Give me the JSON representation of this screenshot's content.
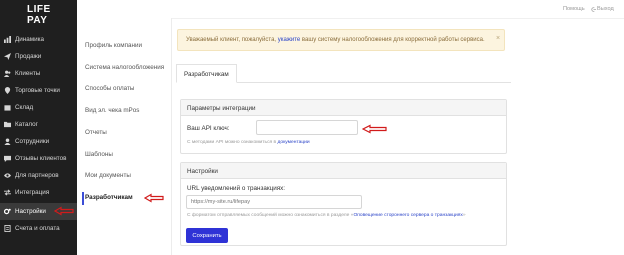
{
  "logo": {
    "line1": "LIFE",
    "line2": "PAY"
  },
  "sidebar": {
    "items": [
      {
        "label": "Динамика",
        "icon": "chart-icon"
      },
      {
        "label": "Продажи",
        "icon": "send-icon"
      },
      {
        "label": "Клиенты",
        "icon": "users-icon"
      },
      {
        "label": "Торговые точки",
        "icon": "map-pin-icon"
      },
      {
        "label": "Склад",
        "icon": "box-icon"
      },
      {
        "label": "Каталог",
        "icon": "folder-icon"
      },
      {
        "label": "Сотрудники",
        "icon": "staff-icon"
      },
      {
        "label": "Отзывы клиентов",
        "icon": "chat-icon"
      },
      {
        "label": "Для партнеров",
        "icon": "eye-icon"
      },
      {
        "label": "Интеграция",
        "icon": "swap-icon"
      },
      {
        "label": "Настройки",
        "icon": "gears-icon"
      },
      {
        "label": "Счета и оплата",
        "icon": "invoice-icon"
      }
    ],
    "active_index": 10
  },
  "submenu": {
    "items": [
      "Профиль компании",
      "Система налогообложения",
      "Способы оплаты",
      "Вид эл. чека mPos",
      "Отчеты",
      "Шаблоны",
      "Мои документы",
      "Разработчикам"
    ],
    "active_index": 7
  },
  "topbar": {
    "help": "Помощь",
    "logout": "Выход"
  },
  "alert": {
    "before": "Уважаемый клиент, пожалуйста,",
    "link": "укажите",
    "after": "вашу систему налогообложения для корректной работы сервиса.",
    "close": "×"
  },
  "tab": {
    "label": "Разработчикам"
  },
  "integration": {
    "title": "Параметры интеграции",
    "api_key_label": "Ваш API ключ:",
    "api_key_value": "",
    "hint_before": "С методами API можно ознакомиться в",
    "hint_link": "документации"
  },
  "settings": {
    "title": "Настройки",
    "url_label": "URL уведомлений о транзакциях:",
    "url_value": "",
    "url_placeholder": "https://my-site.ru/lifepay",
    "hint_before": "С форматом отправляемых сообщений можно ознакомиться в разделе «",
    "hint_link": "Оповещение стороннего сервера о транзакциях",
    "hint_after": "»",
    "save_label": "Сохранить"
  },
  "colors": {
    "sidebar_bg": "#1f1f1f",
    "accent": "#2f33d6",
    "annotation_arrow": "#d11b1b",
    "alert_bg": "#fcf4df"
  }
}
